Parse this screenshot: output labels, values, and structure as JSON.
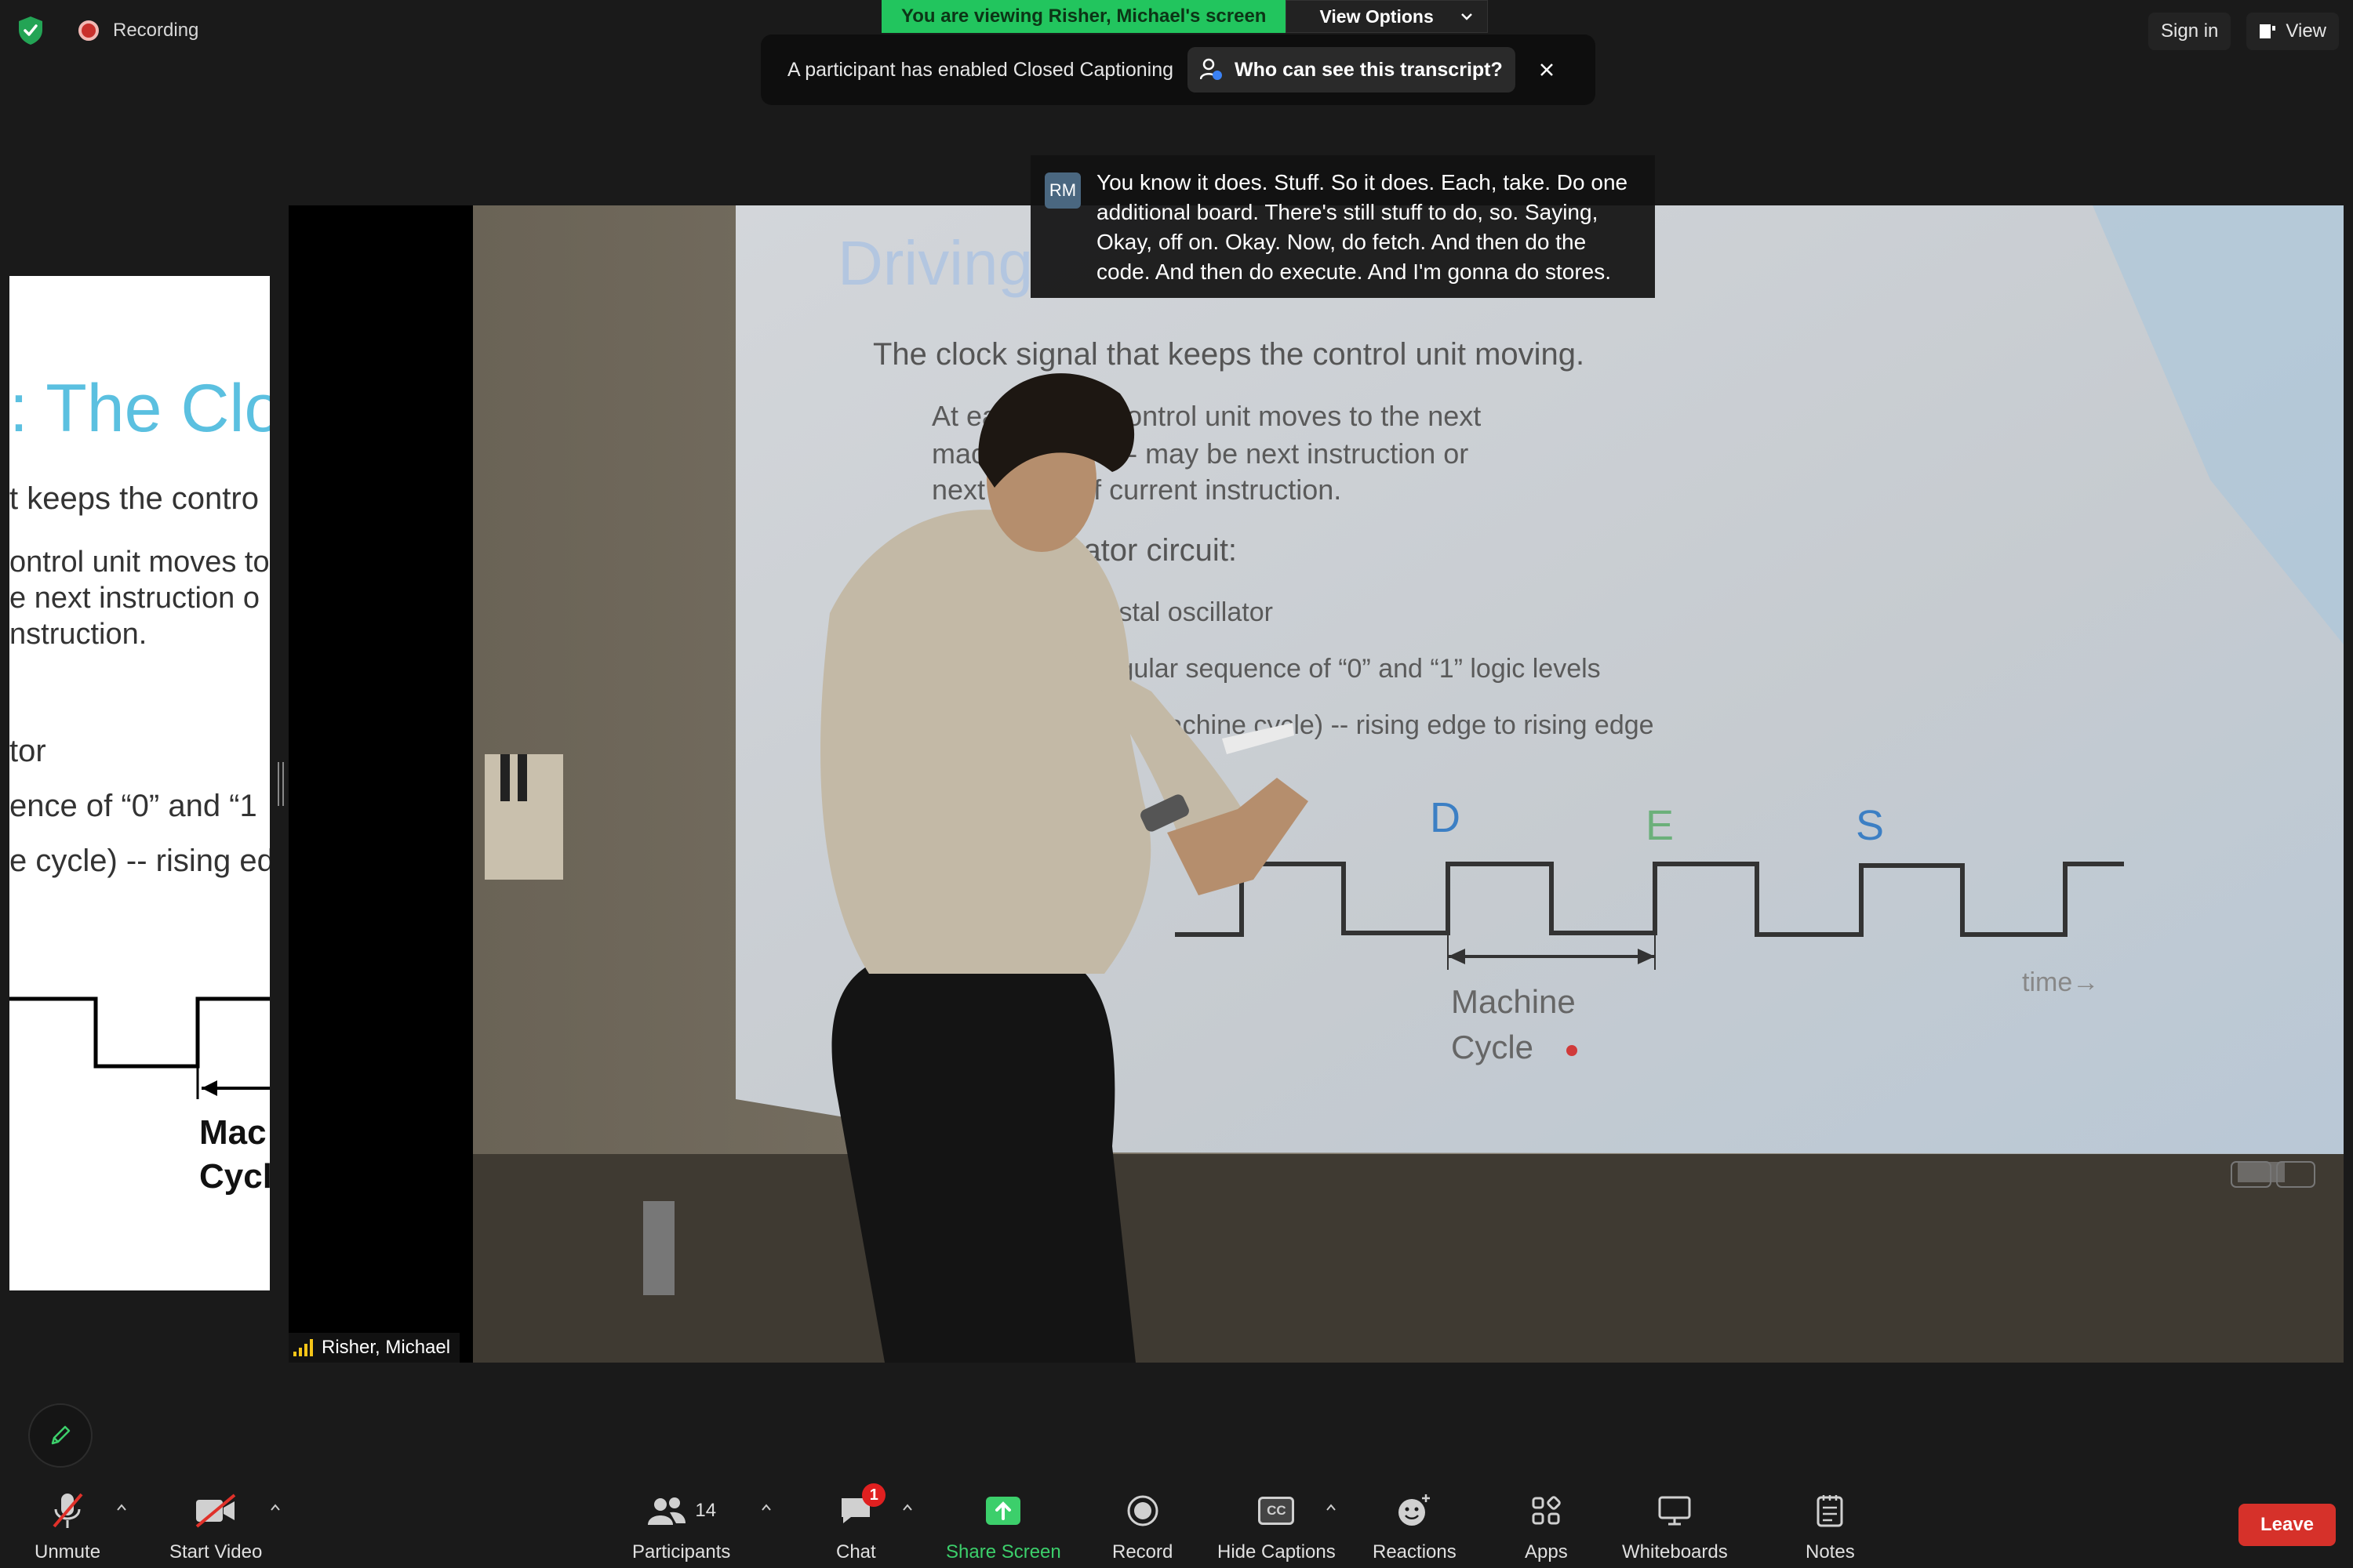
{
  "top": {
    "recording_label": "Recording",
    "viewing_label": "You are viewing Risher, Michael's screen",
    "view_options_label": "View Options",
    "sign_in_label": "Sign in",
    "view_label": "View"
  },
  "cc_banner": {
    "message": "A participant has enabled Closed Captioning",
    "button_label": "Who can see this transcript?"
  },
  "caption": {
    "avatar_initials": "RM",
    "text": "You know it does. Stuff. So it does. Each, take. Do one additional board. There's still stuff to do, so. Saying, Okay, off on. Okay. Now, do fetch. And then do the code. And then do execute. And I'm gonna do stores."
  },
  "side_slide": {
    "title": ": The Clo",
    "lines": [
      "t keeps the contro",
      "ontrol unit moves to",
      "e next instruction o",
      "nstruction.",
      "tor",
      "ence of “0” and “1",
      "e cycle) -- rising edg"
    ],
    "label_1": "Mac",
    "label_2": "Cycle"
  },
  "video": {
    "participant_name": "Risher, Michael",
    "slide_title": "Driving",
    "bullet_1": "The clock signal that keeps the control unit moving.",
    "sub_1a": "At each “tick,” control unit moves to the next",
    "sub_1b": "machine cycle -- may be next instruction or",
    "sub_1c": "next phase of current instruction.",
    "bullet_2": "Clock generator circuit:",
    "sub_2a": "Based on crystal oscillator",
    "sub_2b": "Generates regular sequence of “0” and “1” logic levels",
    "sub_2c": "Clock cycle (or machine cycle) -- rising edge to rising edge",
    "annot_labels": [
      "D",
      "E",
      "S"
    ],
    "machine": "Machine",
    "cycle": "Cycle",
    "time_label": "time→"
  },
  "toolbar": {
    "unmute": "Unmute",
    "start_video": "Start Video",
    "participants": "Participants",
    "participant_count": "14",
    "chat": "Chat",
    "chat_badge": "1",
    "share_screen": "Share Screen",
    "record": "Record",
    "hide_captions": "Hide Captions",
    "cc_icon_text": "CC",
    "reactions": "Reactions",
    "apps": "Apps",
    "whiteboards": "Whiteboards",
    "notes": "Notes",
    "leave": "Leave"
  },
  "colors": {
    "viewing_banner": "#22c55e",
    "leave_button": "#d6312a",
    "share_screen": "#3ccf6b",
    "slide_title_blue": "#5bc0e0"
  }
}
